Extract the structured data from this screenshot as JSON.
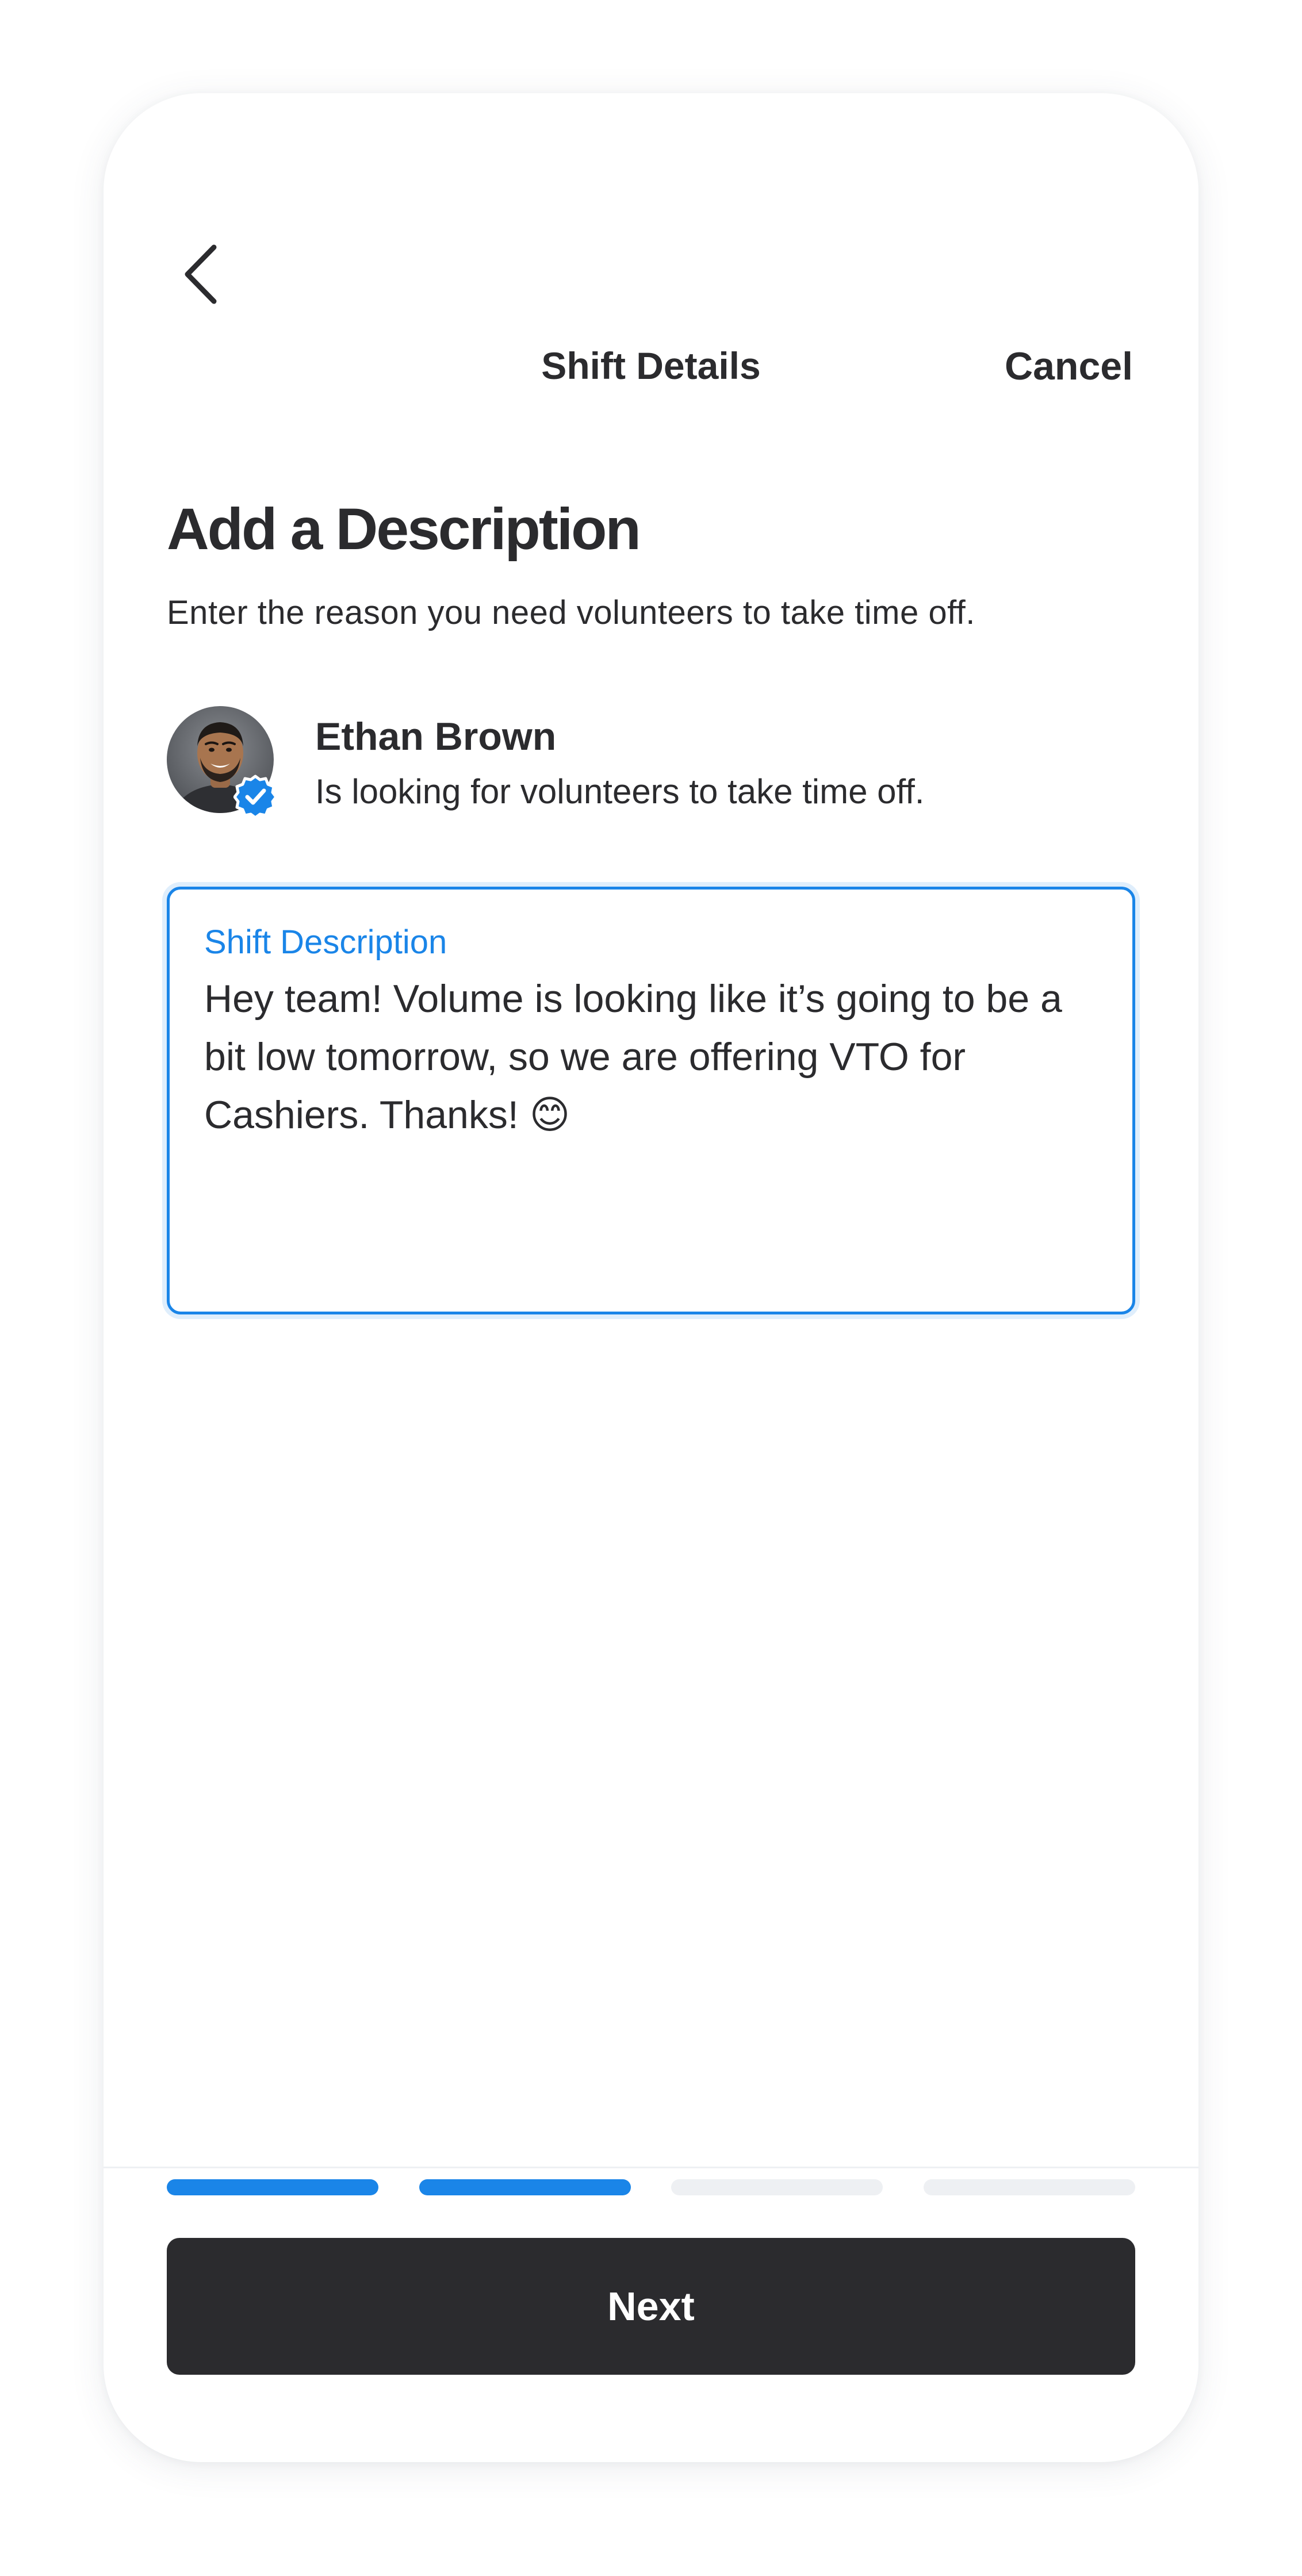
{
  "header": {
    "back_icon": "chevron-left-icon",
    "title": "Shift Details",
    "cancel_label": "Cancel"
  },
  "page": {
    "title": "Add a Description",
    "subtitle": "Enter the reason you need volunteers to take time off."
  },
  "user": {
    "name": "Ethan Brown",
    "status_text": "Is looking for volunteers to take time off.",
    "verified_icon": "verified-badge-icon"
  },
  "description_field": {
    "label": "Shift Description",
    "value": "Hey team! Volume is looking like it’s going to be a bit low tomorrow, so we are offering VTO for Cashiers. Thanks! 😊"
  },
  "progress": {
    "total_steps": 4,
    "completed_steps": 2,
    "active_color": "#1A85E8",
    "inactive_color": "#EEF0F3"
  },
  "footer": {
    "next_label": "Next"
  },
  "colors": {
    "accent": "#1A85E8",
    "text_primary": "#2B2B2E",
    "button_bg": "#2B2B2E"
  }
}
